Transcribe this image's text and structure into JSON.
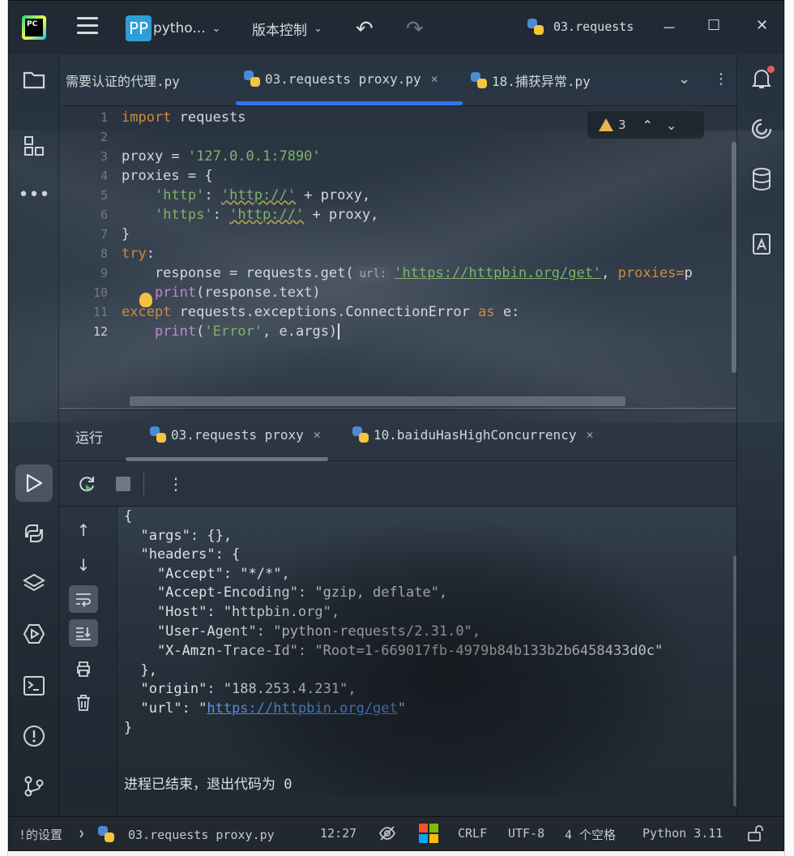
{
  "titlebar": {
    "logo_text": "PC",
    "project_badge": "PP",
    "project_name": "pytho...",
    "vcs_label": "版本控制",
    "run_config": "03.requests",
    "minimize": "－",
    "maximize": "☐",
    "close": "✕"
  },
  "editor_tabs": [
    {
      "label": "需要认证的代理.py"
    },
    {
      "label": "03.requests proxy.py",
      "active": true
    },
    {
      "label": "18.捕获异常.py"
    }
  ],
  "editor": {
    "line_numbers": [
      "1",
      "2",
      "3",
      "4",
      "5",
      "6",
      "7",
      "8",
      "9",
      "10",
      "11",
      "12"
    ],
    "current_line": "12",
    "warnings_count": "3",
    "code": {
      "l1_kw": "import",
      "l1_rest": " requests",
      "l3_a": "proxy = ",
      "l3_s": "'127.0.0.1:7890'",
      "l4": "proxies = {",
      "l5_a": "    ",
      "l5_s1": "'http'",
      "l5_b": ": ",
      "l5_s2": "'http://'",
      "l5_c": " + proxy,",
      "l6_a": "    ",
      "l6_s1": "'https'",
      "l6_b": ": ",
      "l6_s2": "'http://'",
      "l6_c": " + proxy,",
      "l7": "}",
      "l8_kw": "try",
      "l8_rest": ":",
      "l9_a": "    response = requests.get(",
      "l9_hint": "url:",
      "l9_url": "'https://httpbin.org/get'",
      "l9_b": ", ",
      "l9_kw": "proxies=",
      "l9_c": "p",
      "l10_a": "    ",
      "l10_fn": "print",
      "l10_b": "(response.text)",
      "l11_kw": "except",
      "l11_a": " requests.exceptions.ConnectionError ",
      "l11_kw2": "as",
      "l11_b": " e:",
      "l12_a": "    ",
      "l12_fn": "print",
      "l12_b": "(",
      "l12_s": "'Error'",
      "l12_c": ", e.args)"
    }
  },
  "run_panel": {
    "title": "运行",
    "tabs": [
      {
        "label": "03.requests proxy",
        "active": true
      },
      {
        "label": "10.baiduHasHighConcurrency"
      }
    ],
    "output": [
      "{",
      "  \"args\": {},",
      "  \"headers\": {",
      "    \"Accept\": \"*/*\",",
      "    \"Accept-Encoding\": \"gzip, deflate\",",
      "    \"Host\": \"httpbin.org\",",
      "    \"User-Agent\": \"python-requests/2.31.0\",",
      "    \"X-Amzn-Trace-Id\": \"Root=1-669017fb-4979b84b133b2b6458433d0c\"",
      "  },",
      "  \"origin\": \"188.253.4.231\","
    ],
    "url_prefix": "  \"url\": \"",
    "url_link": "https://httpbin.org/get",
    "url_suffix": "\"",
    "closing": "}",
    "exit_message": "进程已结束，退出代码为 0"
  },
  "statusbar": {
    "breadcrumb_settings": "!的设置",
    "breadcrumb_sep": "❯",
    "breadcrumb_file": "03.requests proxy.py",
    "position": "12:27",
    "line_ending": "CRLF",
    "encoding": "UTF-8",
    "indent": "4 个空格",
    "interpreter": "Python 3.11"
  },
  "icons": {
    "project": "folder-icon",
    "structure": "structure-icon",
    "more": "more-icon",
    "run": "run-icon",
    "python_console": "python-console-icon",
    "layers": "layers-icon",
    "services": "services-icon",
    "terminal": "terminal-icon",
    "problems": "problems-icon",
    "git": "git-icon",
    "notifications": "bell-icon",
    "ai": "ai-assistant-icon",
    "database": "database-icon",
    "docs": "documentation-icon"
  },
  "colors": {
    "accent": "#3574f0",
    "keyword": "#d08a3c",
    "string": "#7fb36a",
    "link": "#5b9cf2",
    "warning": "#e6b450"
  }
}
